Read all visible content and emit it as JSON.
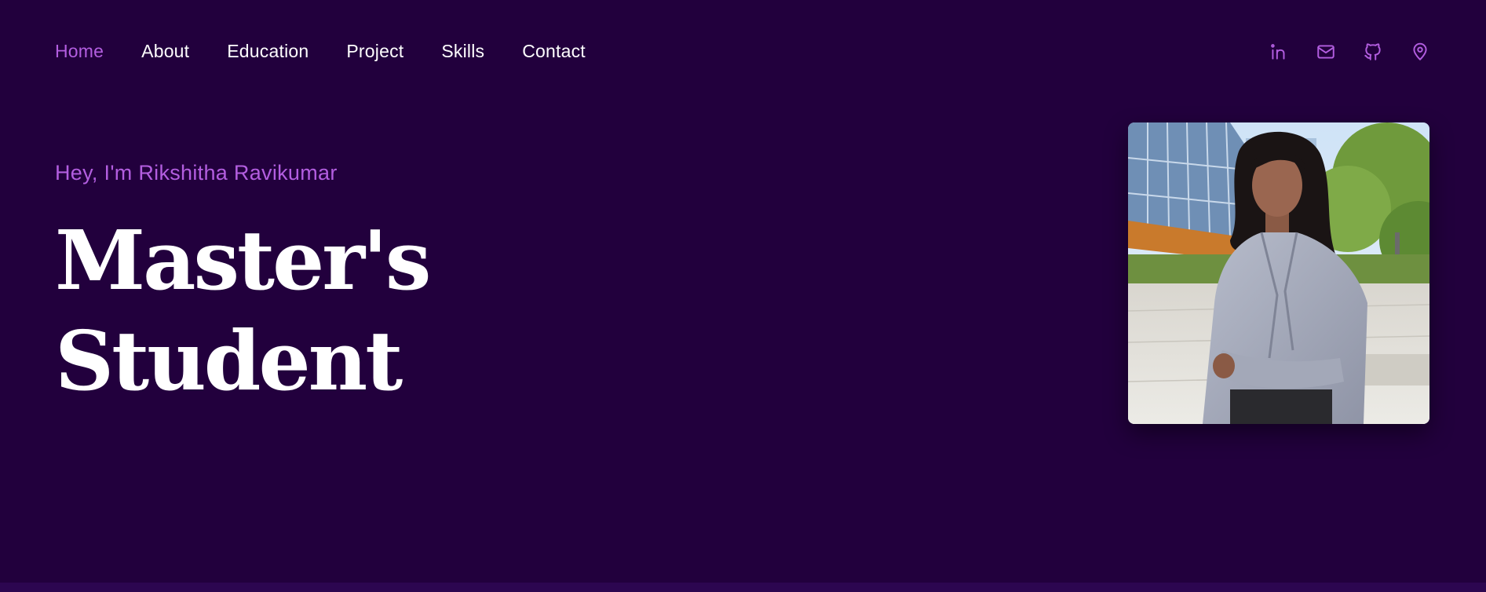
{
  "nav": {
    "items": [
      {
        "label": "Home",
        "active": true
      },
      {
        "label": "About",
        "active": false
      },
      {
        "label": "Education",
        "active": false
      },
      {
        "label": "Project",
        "active": false
      },
      {
        "label": "Skills",
        "active": false
      },
      {
        "label": "Contact",
        "active": false
      }
    ]
  },
  "social": {
    "icons": [
      "linkedin-icon",
      "mail-icon",
      "github-icon",
      "location-icon"
    ]
  },
  "hero": {
    "greeting": "Hey, I'm Rikshitha Ravikumar",
    "headline_line1": "Master's",
    "headline_line2": "Student"
  },
  "colors": {
    "background": "#22003d",
    "accent": "#b35ee0",
    "text": "#ffffff"
  }
}
